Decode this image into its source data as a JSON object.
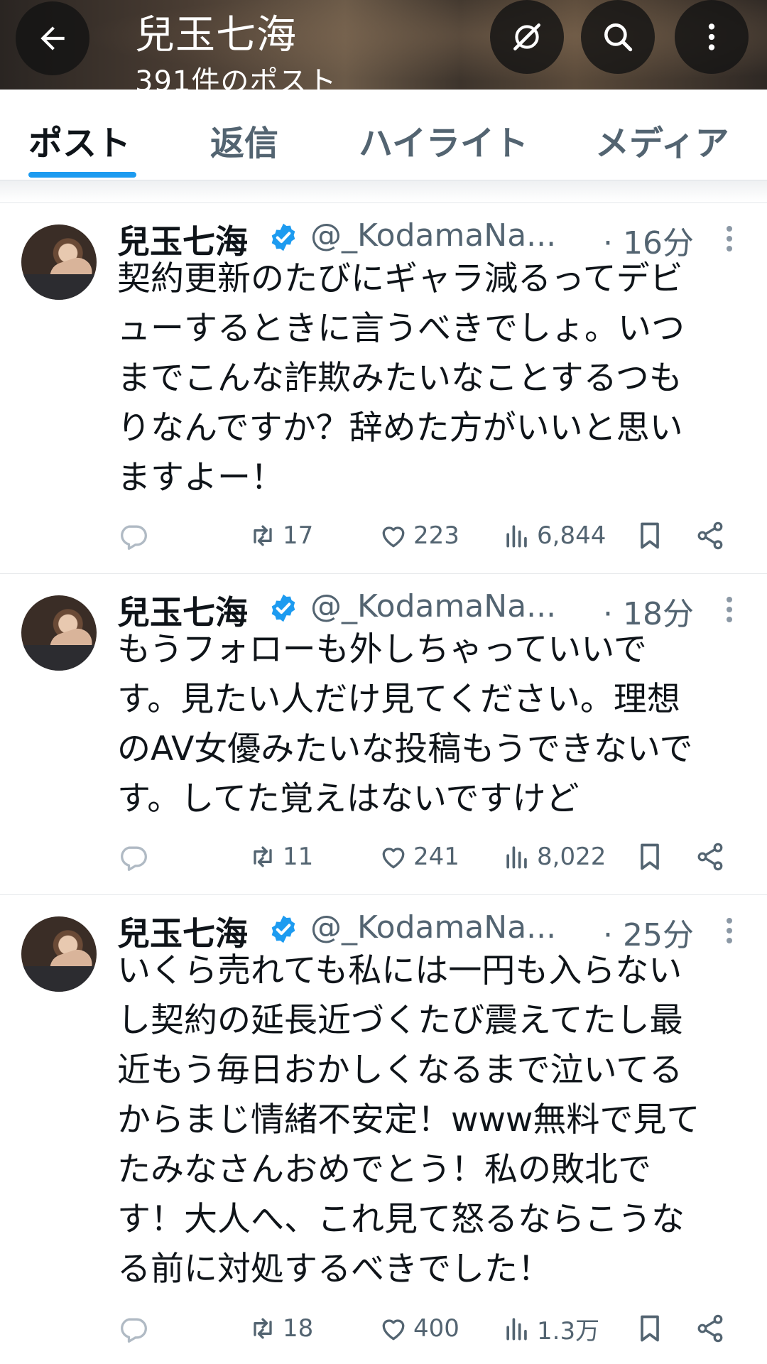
{
  "header": {
    "back_icon": "back-arrow-icon",
    "profile_name": "兒玉七海",
    "post_count": "391件のポスト",
    "nosync_icon": "no-sync-icon",
    "search_icon": "search-icon",
    "more_icon": "more-vertical-icon"
  },
  "tabs": [
    {
      "label": "ポスト",
      "active": true
    },
    {
      "label": "返信",
      "active": false
    },
    {
      "label": "ハイライト",
      "active": false
    },
    {
      "label": "メディア",
      "active": false
    }
  ],
  "colors": {
    "accent": "#1d9bf0",
    "text_primary": "#0f1419",
    "text_secondary": "#536471",
    "verified_badge": "#1d9bf0"
  },
  "posts": [
    {
      "name": "兒玉七海",
      "handle": "@_KodamaNa...",
      "time": "· 16分",
      "lines": [
        "契約更新のたびにギャラ減るってデビ",
        "ューするときに言うべきでしょ。いつ",
        "までこんな詐欺みたいなことするつも",
        "りなんですか？辞めた方がいいと思い",
        "ますよー！"
      ],
      "retweets": "17",
      "likes": "223",
      "views": "6,844"
    },
    {
      "name": "兒玉七海",
      "handle": "@_KodamaNa...",
      "time": "· 18分",
      "lines": [
        "もうフォローも外しちゃっていいで",
        "す。見たい人だけ見てください。理想",
        "のAV女優みたいな投稿もうできないで",
        "す。してた覚えはないですけど"
      ],
      "retweets": "11",
      "likes": "241",
      "views": "8,022"
    },
    {
      "name": "兒玉七海",
      "handle": "@_KodamaNa...",
      "time": "· 25分",
      "lines": [
        "いくら売れても私には一円も入らない",
        "し契約の延長近づくたび震えてたし最",
        "近もう毎日おかしくなるまで泣いてる",
        "からまじ情緒不安定！www無料で見て",
        "たみなさんおめでとう！私の敗北で",
        "す！大人へ、これ見て怒るならこうな",
        "る前に対処するべきでした！"
      ],
      "retweets": "18",
      "likes": "400",
      "views": "1.3万"
    }
  ]
}
